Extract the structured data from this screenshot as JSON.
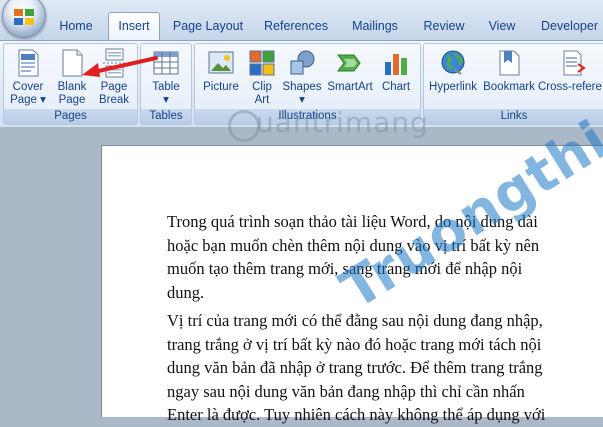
{
  "tabs": [
    {
      "label": "Home"
    },
    {
      "label": "Insert"
    },
    {
      "label": "Page Layout"
    },
    {
      "label": "References"
    },
    {
      "label": "Mailings"
    },
    {
      "label": "Review"
    },
    {
      "label": "View"
    },
    {
      "label": "Developer"
    }
  ],
  "groups": {
    "pages": {
      "label": "Pages",
      "buttons": [
        {
          "line1": "Cover",
          "line2": "Page ▾"
        },
        {
          "line1": "Blank",
          "line2": "Page"
        },
        {
          "line1": "Page",
          "line2": "Break"
        }
      ]
    },
    "tables": {
      "label": "Tables",
      "buttons": [
        {
          "line1": "Table",
          "line2": "▾"
        }
      ]
    },
    "illustrations": {
      "label": "Illustrations",
      "buttons": [
        {
          "line1": "Picture",
          "line2": ""
        },
        {
          "line1": "Clip",
          "line2": "Art"
        },
        {
          "line1": "Shapes",
          "line2": "▾"
        },
        {
          "line1": "SmartArt",
          "line2": ""
        },
        {
          "line1": "Chart",
          "line2": ""
        }
      ]
    },
    "links": {
      "label": "Links",
      "buttons": [
        {
          "line1": "Hyperlink",
          "line2": ""
        },
        {
          "line1": "Bookmark",
          "line2": ""
        },
        {
          "line1": "Cross-refere",
          "line2": ""
        }
      ]
    }
  },
  "watermarks": {
    "quantrimang": "uantrimang",
    "truongthi": "Truongthi.vn"
  },
  "document": {
    "paragraph1": [
      "Trong quá trình soạn thảo tài liệu Word, do nội dung dài",
      "hoặc bạn muốn chèn thêm nội dung vào vị trí bất kỳ nên",
      "muốn tạo thêm trang mới, sang trang mới để nhập nội",
      "dung."
    ],
    "paragraph2": [
      "Vị trí của trang mới có thể đằng sau nội dung đang nhập,",
      "trang trắng ở vị trí bất kỳ nào đó hoặc trang mới tách nội",
      "dung văn bản đã nhập ở trang trước. Để thêm trang trắng",
      "ngay sau nội dung văn bản đang nhập thì chỉ cần nhấn",
      "Enter là được. Tuy nhiên cách này không thể áp dụng với"
    ]
  },
  "colors": {
    "accent_red": "#e02020",
    "ribbon_text": "#15428b",
    "watermark_blue": "#1e78c8"
  }
}
